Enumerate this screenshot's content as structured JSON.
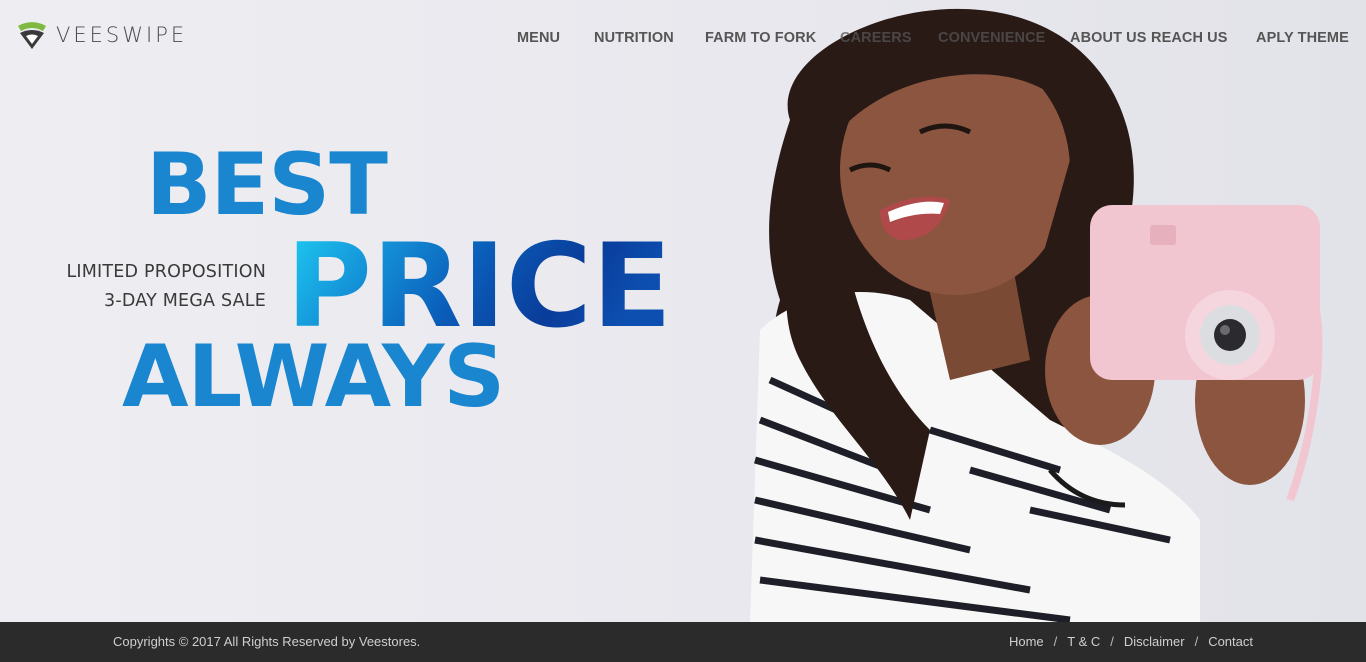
{
  "brand": {
    "name": "VEESWIPE",
    "logo_icon": "leaf-shield-icon"
  },
  "nav": {
    "items": [
      {
        "label": "MENU"
      },
      {
        "label": "NUTRITION"
      },
      {
        "label": "FARM TO FORK"
      },
      {
        "label": "CAREERS"
      },
      {
        "label": "CONVENIENCE"
      },
      {
        "label": "ABOUT US"
      },
      {
        "label": "REACH US"
      },
      {
        "label": "APLY THEME"
      }
    ]
  },
  "hero": {
    "line1": "BEST",
    "line2": "PRICE",
    "line3": "ALWAYS",
    "promo_line1": "LIMITED PROPOSITION",
    "promo_line2": "3-DAY MEGA SALE",
    "accent_color": "#1a86d0"
  },
  "footer": {
    "copyright": "Copyrights © 2017 All Rights Reserved by Veestores.",
    "links": [
      {
        "label": "Home"
      },
      {
        "label": "T & C"
      },
      {
        "label": "Disclaimer"
      },
      {
        "label": "Contact"
      }
    ],
    "separator": "/"
  }
}
